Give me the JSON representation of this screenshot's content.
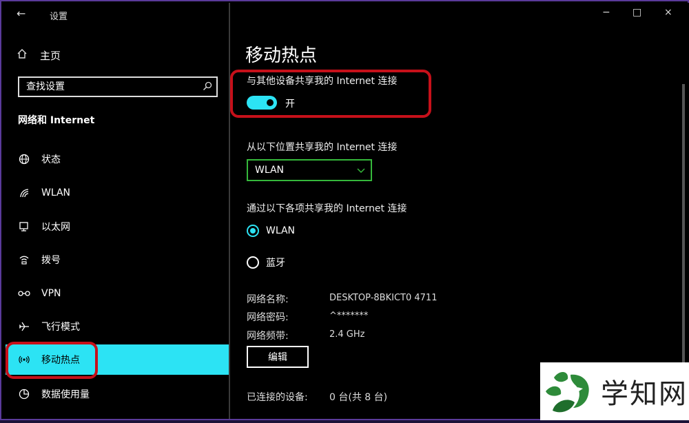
{
  "window": {
    "title": "设置",
    "back_icon": "back-arrow-icon",
    "controls": {
      "minimize": "−",
      "maximize": "□",
      "close": "×"
    }
  },
  "sidebar": {
    "home_label": "主页",
    "search_placeholder": "查找设置",
    "section_title": "网络和 Internet",
    "items": [
      {
        "label": "状态",
        "icon": "globe-icon"
      },
      {
        "label": "WLAN",
        "icon": "wifi-icon"
      },
      {
        "label": "以太网",
        "icon": "ethernet-icon"
      },
      {
        "label": "拨号",
        "icon": "dialup-icon"
      },
      {
        "label": "VPN",
        "icon": "vpn-icon"
      },
      {
        "label": "飞行模式",
        "icon": "airplane-icon"
      },
      {
        "label": "移动热点",
        "icon": "hotspot-icon",
        "active": true
      },
      {
        "label": "数据使用量",
        "icon": "data-usage-icon"
      }
    ]
  },
  "main": {
    "page_title": "移动热点",
    "share_label": "与其他设备共享我的 Internet 连接",
    "toggle_state": "开",
    "toggle_on": true,
    "share_from_label": "从以下位置共享我的 Internet 连接",
    "share_from_value": "WLAN",
    "share_over_label": "通过以下各项共享我的 Internet 连接",
    "share_over_options": [
      {
        "label": "WLAN",
        "selected": true
      },
      {
        "label": "蓝牙",
        "selected": false
      }
    ],
    "network_name_key": "网络名称:",
    "network_name_val": "DESKTOP-8BKICT0 4711",
    "password_key": "网络密码:",
    "password_val": "^*******",
    "band_key": "网络频带:",
    "band_val": "2.4 GHz",
    "edit_label": "编辑",
    "connected_key": "已连接的设备:",
    "connected_val": "0 台(共 8 台)"
  },
  "watermark": {
    "text": "学知网"
  },
  "colors": {
    "accent": "#2ce3f4",
    "highlight": "#c6101a",
    "dropdown_border": "#35b83b",
    "background": "#000000"
  }
}
